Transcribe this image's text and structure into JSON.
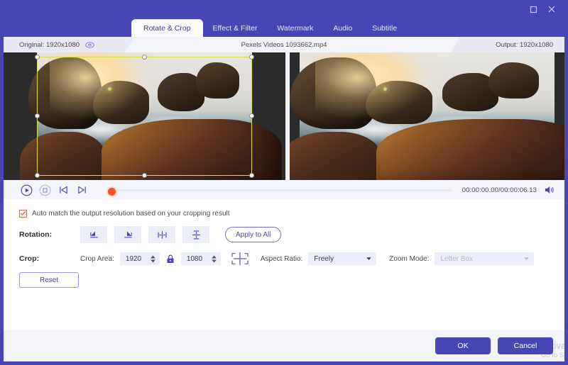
{
  "titlebar": {
    "maximize_label": "maximize",
    "close_label": "close"
  },
  "tabs": [
    {
      "label": "Rotate & Crop",
      "active": true
    },
    {
      "label": "Effect & Filter",
      "active": false
    },
    {
      "label": "Watermark",
      "active": false
    },
    {
      "label": "Audio",
      "active": false
    },
    {
      "label": "Subtitle",
      "active": false
    }
  ],
  "info": {
    "original_label": "Original: 1920x1080",
    "filename": "Pexels Videos 1093662.mp4",
    "output_label": "Output: 1920x1080"
  },
  "player": {
    "timecode": "00:00:00.00/00:00:06.13",
    "current_time": "00:00:00.00",
    "duration": "00:00:06.13"
  },
  "options": {
    "auto_match_label": "Auto match the output resolution based on your cropping result",
    "auto_match_checked": true
  },
  "rotation": {
    "label": "Rotation:",
    "buttons": [
      {
        "name": "rotate-left"
      },
      {
        "name": "rotate-right"
      },
      {
        "name": "flip-horizontal"
      },
      {
        "name": "flip-vertical"
      }
    ],
    "apply_to_all_label": "Apply to All"
  },
  "crop": {
    "label": "Crop:",
    "area_label": "Crop Area:",
    "width_value": "1920",
    "height_value": "1080",
    "aspect_ratio_label": "Aspect Ratio:",
    "aspect_ratio_value": "Freely",
    "zoom_mode_label": "Zoom Mode:",
    "zoom_mode_value": "Letter Box",
    "zoom_mode_disabled": true,
    "reset_label": "Reset"
  },
  "footer": {
    "ok_label": "OK",
    "cancel_label": "Cancel"
  },
  "watermark": {
    "line1": "Activat",
    "line2": "Go to Se"
  },
  "colors": {
    "brand": "#4a45b5",
    "panel": "#f4f5fb",
    "crop_border": "#d7dc4a",
    "checkbox": "#f0663c",
    "playhead": "#f4512c"
  }
}
